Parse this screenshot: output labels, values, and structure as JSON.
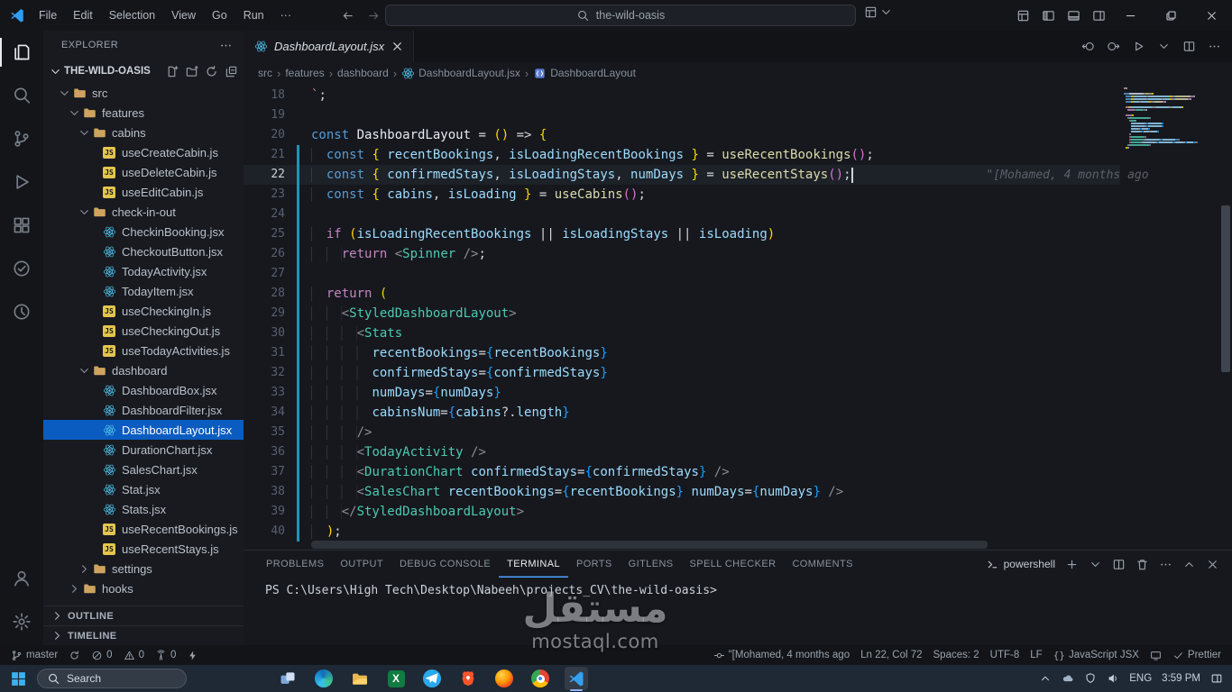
{
  "colors": {
    "accent_blue": "#4da1ff",
    "selection_blue": "#0b5cc0",
    "keyword": "#569cd6",
    "control_keyword": "#c586c0",
    "variable": "#9cdcfe",
    "function": "#dcdcaa",
    "component": "#4ec9b0",
    "bracket_gold": "#ffd700",
    "bracket_pink": "#da70d6",
    "bracket_blue": "#179fff",
    "git_modified": "#1d96b5",
    "js_icon_yellow": "#e3c54e",
    "react_icon_blue": "#4fc1e9"
  },
  "titlebar": {
    "menus": [
      "File",
      "Edit",
      "Selection",
      "View",
      "Go",
      "Run",
      "···"
    ],
    "search_value": "the-wild-oasis",
    "layout_icons": [
      {
        "name": "customize-layout-icon"
      },
      {
        "name": "toggle-sidebar-icon"
      },
      {
        "name": "toggle-panel-icon"
      },
      {
        "name": "toggle-secondary-sidebar-icon"
      }
    ],
    "window_controls": [
      {
        "name": "minimize-icon"
      },
      {
        "name": "maximize-icon"
      },
      {
        "name": "close-icon"
      }
    ]
  },
  "activitybar": {
    "top": [
      {
        "name": "explorer-icon",
        "active": true
      },
      {
        "name": "search-activity-icon"
      },
      {
        "name": "source-control-icon"
      },
      {
        "name": "run-debug-icon"
      },
      {
        "name": "extensions-icon"
      },
      {
        "name": "extension-a-icon"
      },
      {
        "name": "extension-b-icon"
      }
    ],
    "bottom": [
      {
        "name": "account-icon"
      },
      {
        "name": "settings-gear-icon"
      }
    ]
  },
  "explorer": {
    "title": "EXPLORER",
    "root": "THE-WILD-OASIS",
    "actions": [
      "new-file-icon",
      "new-folder-icon",
      "refresh-icon",
      "collapse-all-icon"
    ],
    "tree": [
      {
        "label": "src",
        "type": "folder",
        "depth": 1,
        "state": "expanded"
      },
      {
        "label": "features",
        "type": "folder",
        "depth": 2,
        "state": "expanded"
      },
      {
        "label": "cabins",
        "type": "folder",
        "depth": 3,
        "state": "expanded"
      },
      {
        "label": "useCreateCabin.js",
        "type": "js",
        "depth": 4
      },
      {
        "label": "useDeleteCabin.js",
        "type": "js",
        "depth": 4
      },
      {
        "label": "useEditCabin.js",
        "type": "js",
        "depth": 4
      },
      {
        "label": "check-in-out",
        "type": "folder",
        "depth": 3,
        "state": "expanded"
      },
      {
        "label": "CheckinBooking.jsx",
        "type": "jsx",
        "depth": 4
      },
      {
        "label": "CheckoutButton.jsx",
        "type": "jsx",
        "depth": 4
      },
      {
        "label": "TodayActivity.jsx",
        "type": "jsx",
        "depth": 4
      },
      {
        "label": "TodayItem.jsx",
        "type": "jsx",
        "depth": 4
      },
      {
        "label": "useCheckingIn.js",
        "type": "js",
        "depth": 4
      },
      {
        "label": "useCheckingOut.js",
        "type": "js",
        "depth": 4
      },
      {
        "label": "useTodayActivities.js",
        "type": "js",
        "depth": 4
      },
      {
        "label": "dashboard",
        "type": "folder",
        "depth": 3,
        "state": "expanded"
      },
      {
        "label": "DashboardBox.jsx",
        "type": "jsx",
        "depth": 4
      },
      {
        "label": "DashboardFilter.jsx",
        "type": "jsx",
        "depth": 4
      },
      {
        "label": "DashboardLayout.jsx",
        "type": "jsx",
        "depth": 4,
        "selected": true
      },
      {
        "label": "DurationChart.jsx",
        "type": "jsx",
        "depth": 4
      },
      {
        "label": "SalesChart.jsx",
        "type": "jsx",
        "depth": 4
      },
      {
        "label": "Stat.jsx",
        "type": "jsx",
        "depth": 4
      },
      {
        "label": "Stats.jsx",
        "type": "jsx",
        "depth": 4
      },
      {
        "label": "useRecentBookings.js",
        "type": "js",
        "depth": 4
      },
      {
        "label": "useRecentStays.js",
        "type": "js",
        "depth": 4
      },
      {
        "label": "settings",
        "type": "folder",
        "depth": 3,
        "state": "collapsed"
      },
      {
        "label": "hooks",
        "type": "folder",
        "depth": 2,
        "state": "collapsed"
      }
    ],
    "sections": [
      "OUTLINE",
      "TIMELINE"
    ]
  },
  "editor": {
    "tab": {
      "label": "DashboardLayout.jsx"
    },
    "actions": [
      {
        "name": "prev-change-icon"
      },
      {
        "name": "next-change-icon"
      },
      {
        "name": "run-icon",
        "chevron": true
      },
      {
        "name": "split-editor-icon"
      },
      {
        "name": "more-icon"
      }
    ],
    "breadcrumbs": [
      "src",
      "features",
      "dashboard",
      "DashboardLayout.jsx",
      "DashboardLayout"
    ],
    "code_lines": [
      {
        "n": 18,
        "t": [
          [
            "t-str",
            "`"
          ],
          [
            "t-plain",
            ";"
          ]
        ]
      },
      {
        "n": 19,
        "t": []
      },
      {
        "n": 20,
        "t": [
          [
            "t-kw",
            "const "
          ],
          [
            "t-bright",
            "DashboardLayout"
          ],
          [
            "t-op",
            " = "
          ],
          [
            "t-b1",
            "()"
          ],
          [
            "t-op",
            " => "
          ],
          [
            "t-b1",
            "{"
          ]
        ]
      },
      {
        "n": 21,
        "m": true,
        "t": [
          [
            "t-ws",
            "  "
          ],
          [
            "t-kw",
            "const "
          ],
          [
            "t-b1",
            "{ "
          ],
          [
            "t-var",
            "recentBookings"
          ],
          [
            "t-plain",
            ", "
          ],
          [
            "t-var",
            "isLoadingRecentBookings"
          ],
          [
            "t-b1",
            " }"
          ],
          [
            "t-op",
            " = "
          ],
          [
            "t-fn",
            "useRecentBookings"
          ],
          [
            "t-b2",
            "()"
          ],
          [
            "t-plain",
            ";"
          ]
        ]
      },
      {
        "n": 22,
        "m": true,
        "c": true,
        "b": "\"[Mohamed, 4 months ago",
        "t": [
          [
            "t-ws",
            "  "
          ],
          [
            "t-kw",
            "const "
          ],
          [
            "t-b1",
            "{ "
          ],
          [
            "t-var",
            "confirmedStays"
          ],
          [
            "t-plain",
            ", "
          ],
          [
            "t-var",
            "isLoadingStays"
          ],
          [
            "t-plain",
            ", "
          ],
          [
            "t-var",
            "numDays"
          ],
          [
            "t-b1",
            " }"
          ],
          [
            "t-op",
            " = "
          ],
          [
            "t-fn",
            "useRecentStays"
          ],
          [
            "t-b2",
            "()"
          ],
          [
            "t-plain",
            ";"
          ]
        ]
      },
      {
        "n": 23,
        "m": true,
        "t": [
          [
            "t-ws",
            "  "
          ],
          [
            "t-kw",
            "const "
          ],
          [
            "t-b1",
            "{ "
          ],
          [
            "t-var",
            "cabins"
          ],
          [
            "t-plain",
            ", "
          ],
          [
            "t-var",
            "isLoading"
          ],
          [
            "t-b1",
            " }"
          ],
          [
            "t-op",
            " = "
          ],
          [
            "t-fn",
            "useCabins"
          ],
          [
            "t-b2",
            "()"
          ],
          [
            "t-plain",
            ";"
          ]
        ]
      },
      {
        "n": 24,
        "m": true,
        "t": []
      },
      {
        "n": 25,
        "m": true,
        "t": [
          [
            "t-ws",
            "  "
          ],
          [
            "t-ctl",
            "if "
          ],
          [
            "t-b1",
            "("
          ],
          [
            "t-var",
            "isLoadingRecentBookings"
          ],
          [
            "t-op",
            " || "
          ],
          [
            "t-var",
            "isLoadingStays"
          ],
          [
            "t-op",
            " || "
          ],
          [
            "t-var",
            "isLoading"
          ],
          [
            "t-b1",
            ")"
          ]
        ]
      },
      {
        "n": 26,
        "m": true,
        "t": [
          [
            "t-ws",
            "    "
          ],
          [
            "t-ctl",
            "return "
          ],
          [
            "t-tag",
            "<"
          ],
          [
            "t-comp",
            "Spinner"
          ],
          [
            "t-tag",
            " />"
          ],
          [
            "t-plain",
            ";"
          ]
        ]
      },
      {
        "n": 27,
        "m": true,
        "t": []
      },
      {
        "n": 28,
        "m": true,
        "t": [
          [
            "t-ws",
            "  "
          ],
          [
            "t-ctl",
            "return "
          ],
          [
            "t-b1",
            "("
          ]
        ]
      },
      {
        "n": 29,
        "m": true,
        "t": [
          [
            "t-ws",
            "    "
          ],
          [
            "t-tag",
            "<"
          ],
          [
            "t-comp",
            "StyledDashboardLayout"
          ],
          [
            "t-tag",
            ">"
          ]
        ]
      },
      {
        "n": 30,
        "m": true,
        "t": [
          [
            "t-ws",
            "      "
          ],
          [
            "t-tag",
            "<"
          ],
          [
            "t-comp",
            "Stats"
          ]
        ]
      },
      {
        "n": 31,
        "m": true,
        "t": [
          [
            "t-ws",
            "        "
          ],
          [
            "t-var",
            "recentBookings"
          ],
          [
            "t-op",
            "="
          ],
          [
            "t-b3",
            "{"
          ],
          [
            "t-var",
            "recentBookings"
          ],
          [
            "t-b3",
            "}"
          ]
        ]
      },
      {
        "n": 32,
        "m": true,
        "t": [
          [
            "t-ws",
            "        "
          ],
          [
            "t-var",
            "confirmedStays"
          ],
          [
            "t-op",
            "="
          ],
          [
            "t-b3",
            "{"
          ],
          [
            "t-var",
            "confirmedStays"
          ],
          [
            "t-b3",
            "}"
          ]
        ]
      },
      {
        "n": 33,
        "m": true,
        "t": [
          [
            "t-ws",
            "        "
          ],
          [
            "t-var",
            "numDays"
          ],
          [
            "t-op",
            "="
          ],
          [
            "t-b3",
            "{"
          ],
          [
            "t-var",
            "numDays"
          ],
          [
            "t-b3",
            "}"
          ]
        ]
      },
      {
        "n": 34,
        "m": true,
        "t": [
          [
            "t-ws",
            "        "
          ],
          [
            "t-var",
            "cabinsNum"
          ],
          [
            "t-op",
            "="
          ],
          [
            "t-b3",
            "{"
          ],
          [
            "t-var",
            "cabins"
          ],
          [
            "t-op",
            "?."
          ],
          [
            "t-var",
            "length"
          ],
          [
            "t-b3",
            "}"
          ]
        ]
      },
      {
        "n": 35,
        "m": true,
        "t": [
          [
            "t-ws",
            "      "
          ],
          [
            "t-tag",
            "/>"
          ]
        ]
      },
      {
        "n": 36,
        "m": true,
        "t": [
          [
            "t-ws",
            "      "
          ],
          [
            "t-tag",
            "<"
          ],
          [
            "t-comp",
            "TodayActivity"
          ],
          [
            "t-tag",
            " />"
          ]
        ]
      },
      {
        "n": 37,
        "m": true,
        "t": [
          [
            "t-ws",
            "      "
          ],
          [
            "t-tag",
            "<"
          ],
          [
            "t-comp",
            "DurationChart"
          ],
          [
            "t-plain",
            " "
          ],
          [
            "t-var",
            "confirmedStays"
          ],
          [
            "t-op",
            "="
          ],
          [
            "t-b3",
            "{"
          ],
          [
            "t-var",
            "confirmedStays"
          ],
          [
            "t-b3",
            "}"
          ],
          [
            "t-tag",
            " />"
          ]
        ]
      },
      {
        "n": 38,
        "m": true,
        "t": [
          [
            "t-ws",
            "      "
          ],
          [
            "t-tag",
            "<"
          ],
          [
            "t-comp",
            "SalesChart"
          ],
          [
            "t-plain",
            " "
          ],
          [
            "t-var",
            "recentBookings"
          ],
          [
            "t-op",
            "="
          ],
          [
            "t-b3",
            "{"
          ],
          [
            "t-var",
            "recentBookings"
          ],
          [
            "t-b3",
            "}"
          ],
          [
            "t-plain",
            " "
          ],
          [
            "t-var",
            "numDays"
          ],
          [
            "t-op",
            "="
          ],
          [
            "t-b3",
            "{"
          ],
          [
            "t-var",
            "numDays"
          ],
          [
            "t-b3",
            "}"
          ],
          [
            "t-tag",
            " />"
          ]
        ]
      },
      {
        "n": 39,
        "m": true,
        "t": [
          [
            "t-ws",
            "    "
          ],
          [
            "t-tag",
            "</"
          ],
          [
            "t-comp",
            "StyledDashboardLayout"
          ],
          [
            "t-tag",
            ">"
          ]
        ]
      },
      {
        "n": 40,
        "m": true,
        "t": [
          [
            "t-ws",
            "  "
          ],
          [
            "t-b1",
            ")"
          ],
          [
            "t-plain",
            ";"
          ]
        ]
      }
    ]
  },
  "panel": {
    "tabs": [
      "PROBLEMS",
      "OUTPUT",
      "DEBUG CONSOLE",
      "TERMINAL",
      "PORTS",
      "GITLENS",
      "SPELL CHECKER",
      "COMMENTS"
    ],
    "active_tab": "TERMINAL",
    "shell_label": "powershell",
    "actions": [
      {
        "name": "plus-icon"
      },
      {
        "name": "chevron-down-icon"
      },
      {
        "name": "split-editor-icon"
      },
      {
        "name": "trash-icon"
      },
      {
        "name": "more-icon"
      },
      {
        "name": "chevron-up-icon"
      },
      {
        "name": "close-icon"
      }
    ],
    "prompt": "PS C:\\Users\\High Tech\\Desktop\\Nabeeh\\projects_CV\\the-wild-oasis>"
  },
  "statusbar": {
    "left": [
      {
        "id": "branch",
        "icon": "git-branch-icon",
        "label": "master"
      },
      {
        "id": "sync",
        "icon": "sync-icon",
        "label": ""
      },
      {
        "id": "errors",
        "icon": "error-icon",
        "label": "0"
      },
      {
        "id": "warnings",
        "icon": "warning-icon",
        "label": "0"
      },
      {
        "id": "ports",
        "icon": "radio-tower-icon",
        "label": "0"
      },
      {
        "id": "zap",
        "icon": "zap-icon",
        "label": ""
      }
    ],
    "right": [
      {
        "id": "blame",
        "icon": "commit-icon",
        "label": "\"[Mohamed, 4 months ago"
      },
      {
        "id": "cursor-position",
        "label": "Ln 22, Col 72"
      },
      {
        "id": "indentation",
        "label": "Spaces: 2"
      },
      {
        "id": "encoding",
        "label": "UTF-8"
      },
      {
        "id": "eol",
        "label": "LF"
      },
      {
        "id": "language",
        "icon": "braces-icon",
        "label": "JavaScript JSX"
      },
      {
        "id": "screen",
        "icon": "screen-icon",
        "label": ""
      },
      {
        "id": "prettier",
        "icon": "check-icon",
        "label": "Prettier"
      }
    ]
  },
  "taskbar": {
    "search_label": "Search",
    "icons": [
      {
        "name": "task-view-icon"
      },
      {
        "name": "edge-icon"
      },
      {
        "name": "file-explorer-icon"
      },
      {
        "name": "excel-icon"
      },
      {
        "name": "telegram-icon"
      },
      {
        "name": "brave-icon"
      },
      {
        "name": "firefox-icon"
      },
      {
        "name": "chrome-icon"
      },
      {
        "name": "vscode-icon",
        "active": true
      }
    ],
    "tray_icons": [
      {
        "name": "tray-chevron-icon"
      },
      {
        "name": "onedrive-icon"
      },
      {
        "name": "security-icon"
      },
      {
        "name": "volume-icon"
      }
    ],
    "tray_lang": "ENG",
    "tray_time": "3:59 PM"
  },
  "watermark": {
    "title": "مستقل",
    "subtitle": "mostaql.com"
  }
}
